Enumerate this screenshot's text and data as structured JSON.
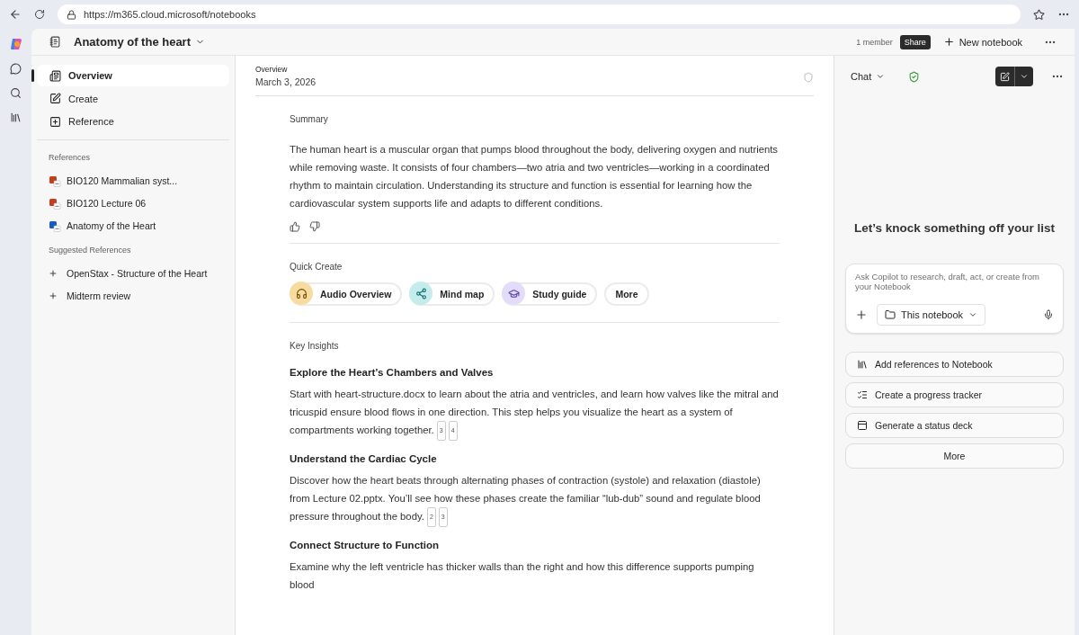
{
  "browser": {
    "url": "https://m365.cloud.microsoft/notebooks"
  },
  "header": {
    "title": "Anatomy of the heart",
    "members": "1 member",
    "share": "Share",
    "new_notebook": "New notebook"
  },
  "nav": [
    {
      "label": "Overview",
      "selected": true
    },
    {
      "label": "Create",
      "selected": false
    },
    {
      "label": "Reference",
      "selected": false
    }
  ],
  "references": {
    "heading": "References",
    "items": [
      {
        "label": "BIO120 Mammalian syst...",
        "kind": "ppt"
      },
      {
        "label": "BIO120 Lecture 06",
        "kind": "ppt"
      },
      {
        "label": "Anatomy of the Heart",
        "kind": "word"
      }
    ]
  },
  "suggested": {
    "heading": "Suggested References",
    "items": [
      "OpenStax - Structure of the Heart",
      "Midterm review"
    ]
  },
  "main": {
    "kicker": "Overview",
    "date": "March 3, 2026",
    "summary_heading": "Summary",
    "summary": "The human heart is a muscular organ that pumps blood throughout the body, delivering oxygen and nutrients while removing waste. It consists of four chambers—two atria and two ventricles—working in a coordinated rhythm to maintain circulation. Understanding its structure and function is essential for learning how the cardiovascular system supports life and adapts to different conditions.",
    "quick_create_heading": "Quick Create",
    "quick_create": [
      {
        "label": "Audio Overview",
        "kind": "audio"
      },
      {
        "label": "Mind map",
        "kind": "mindmap"
      },
      {
        "label": "Study guide",
        "kind": "study"
      },
      {
        "label": "More",
        "kind": "plain"
      }
    ],
    "insights_heading": "Key Insights",
    "insights": [
      {
        "title": "Explore the Heart’s Chambers and Valves",
        "body": "Start with heart-structure.docx to learn about the atria and ventricles, and learn how valves like the mitral and tricuspid ensure blood flows in one direction. This step helps you visualize the heart as a system of compartments working together.",
        "citations": [
          "3",
          "4"
        ]
      },
      {
        "title": "Understand the Cardiac Cycle",
        "body": "Discover how the heart beats through alternating phases of contraction (systole) and relaxation (diastole) from Lecture 02.pptx. You’ll see how these phases create the familiar “lub-dub” sound and regulate blood pressure throughout the body.",
        "citations": [
          "2",
          "3"
        ]
      },
      {
        "title": "Connect Structure to Function",
        "body": "Examine why the left ventricle has thicker walls than the right and how this difference supports pumping blood"
      }
    ]
  },
  "chat": {
    "mode": "Chat",
    "greeting": "Let’s knock something off your list",
    "placeholder": "Ask Copilot to research, draft, act, or create from your Notebook",
    "scope": "This notebook",
    "suggestions": [
      "Add references to Notebook",
      "Create a progress tracker",
      "Generate a status deck",
      "More"
    ]
  }
}
